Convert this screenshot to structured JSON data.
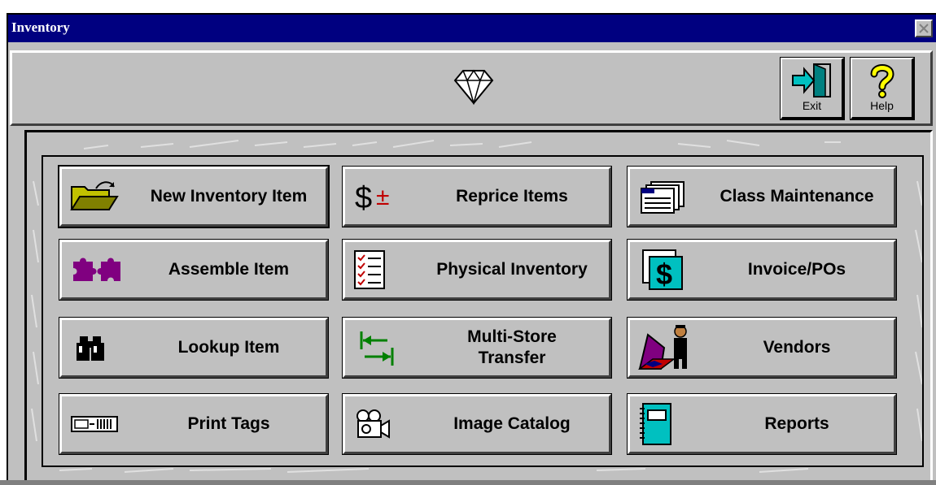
{
  "window": {
    "title": "Inventory"
  },
  "toolbar": {
    "logo_icon": "diamond-icon",
    "exit_label": "Exit",
    "help_label": "Help"
  },
  "menu": {
    "new_inventory_item": "New Inventory Item",
    "reprice_items": "Reprice Items",
    "class_maintenance": "Class Maintenance",
    "assemble_item": "Assemble Item",
    "physical_inventory": "Physical Inventory",
    "invoice_pos": "Invoice/POs",
    "lookup_item": "Lookup Item",
    "multi_store_transfer_line1": "Multi-Store",
    "multi_store_transfer_line2": "Transfer",
    "vendors": "Vendors",
    "print_tags": "Print Tags",
    "image_catalog": "Image Catalog",
    "reports": "Reports"
  },
  "colors": {
    "titlebar": "#000080",
    "face": "#c0c0c0",
    "exit_arrow": "#00c0c0",
    "help_mark": "#ffff00",
    "assemble_purple": "#800080",
    "transfer_green": "#008000",
    "reprice_red": "#c00000",
    "reports_teal": "#00c0c0"
  }
}
